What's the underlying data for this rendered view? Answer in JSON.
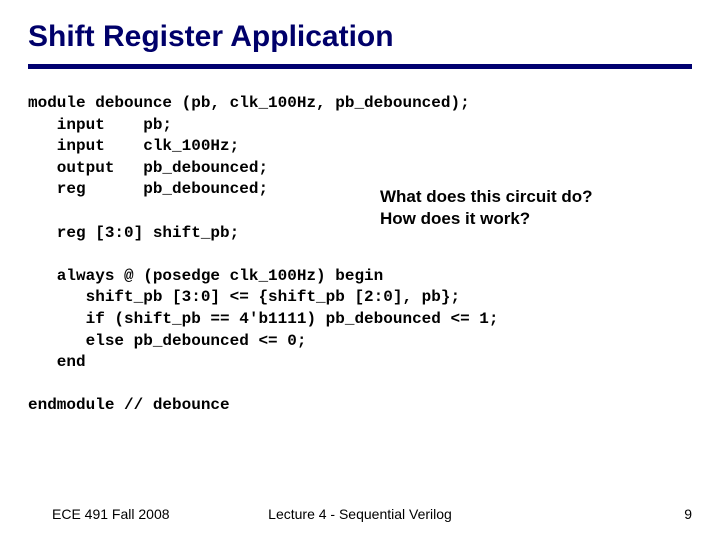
{
  "title": "Shift Register Application",
  "code": "module debounce (pb, clk_100Hz, pb_debounced);\n   input    pb;\n   input    clk_100Hz;\n   output   pb_debounced;\n   reg      pb_debounced;\n\n   reg [3:0] shift_pb;\n\n   always @ (posedge clk_100Hz) begin\n      shift_pb [3:0] <= {shift_pb [2:0], pb};\n      if (shift_pb == 4'b1111) pb_debounced <= 1;\n      else pb_debounced <= 0;\n   end\n\nendmodule // debounce",
  "callout": {
    "line1": "What does this circuit do?",
    "line2": "How does it work?"
  },
  "footer": {
    "left": "ECE 491 Fall 2008",
    "center": "Lecture 4 - Sequential Verilog",
    "right": "9"
  }
}
